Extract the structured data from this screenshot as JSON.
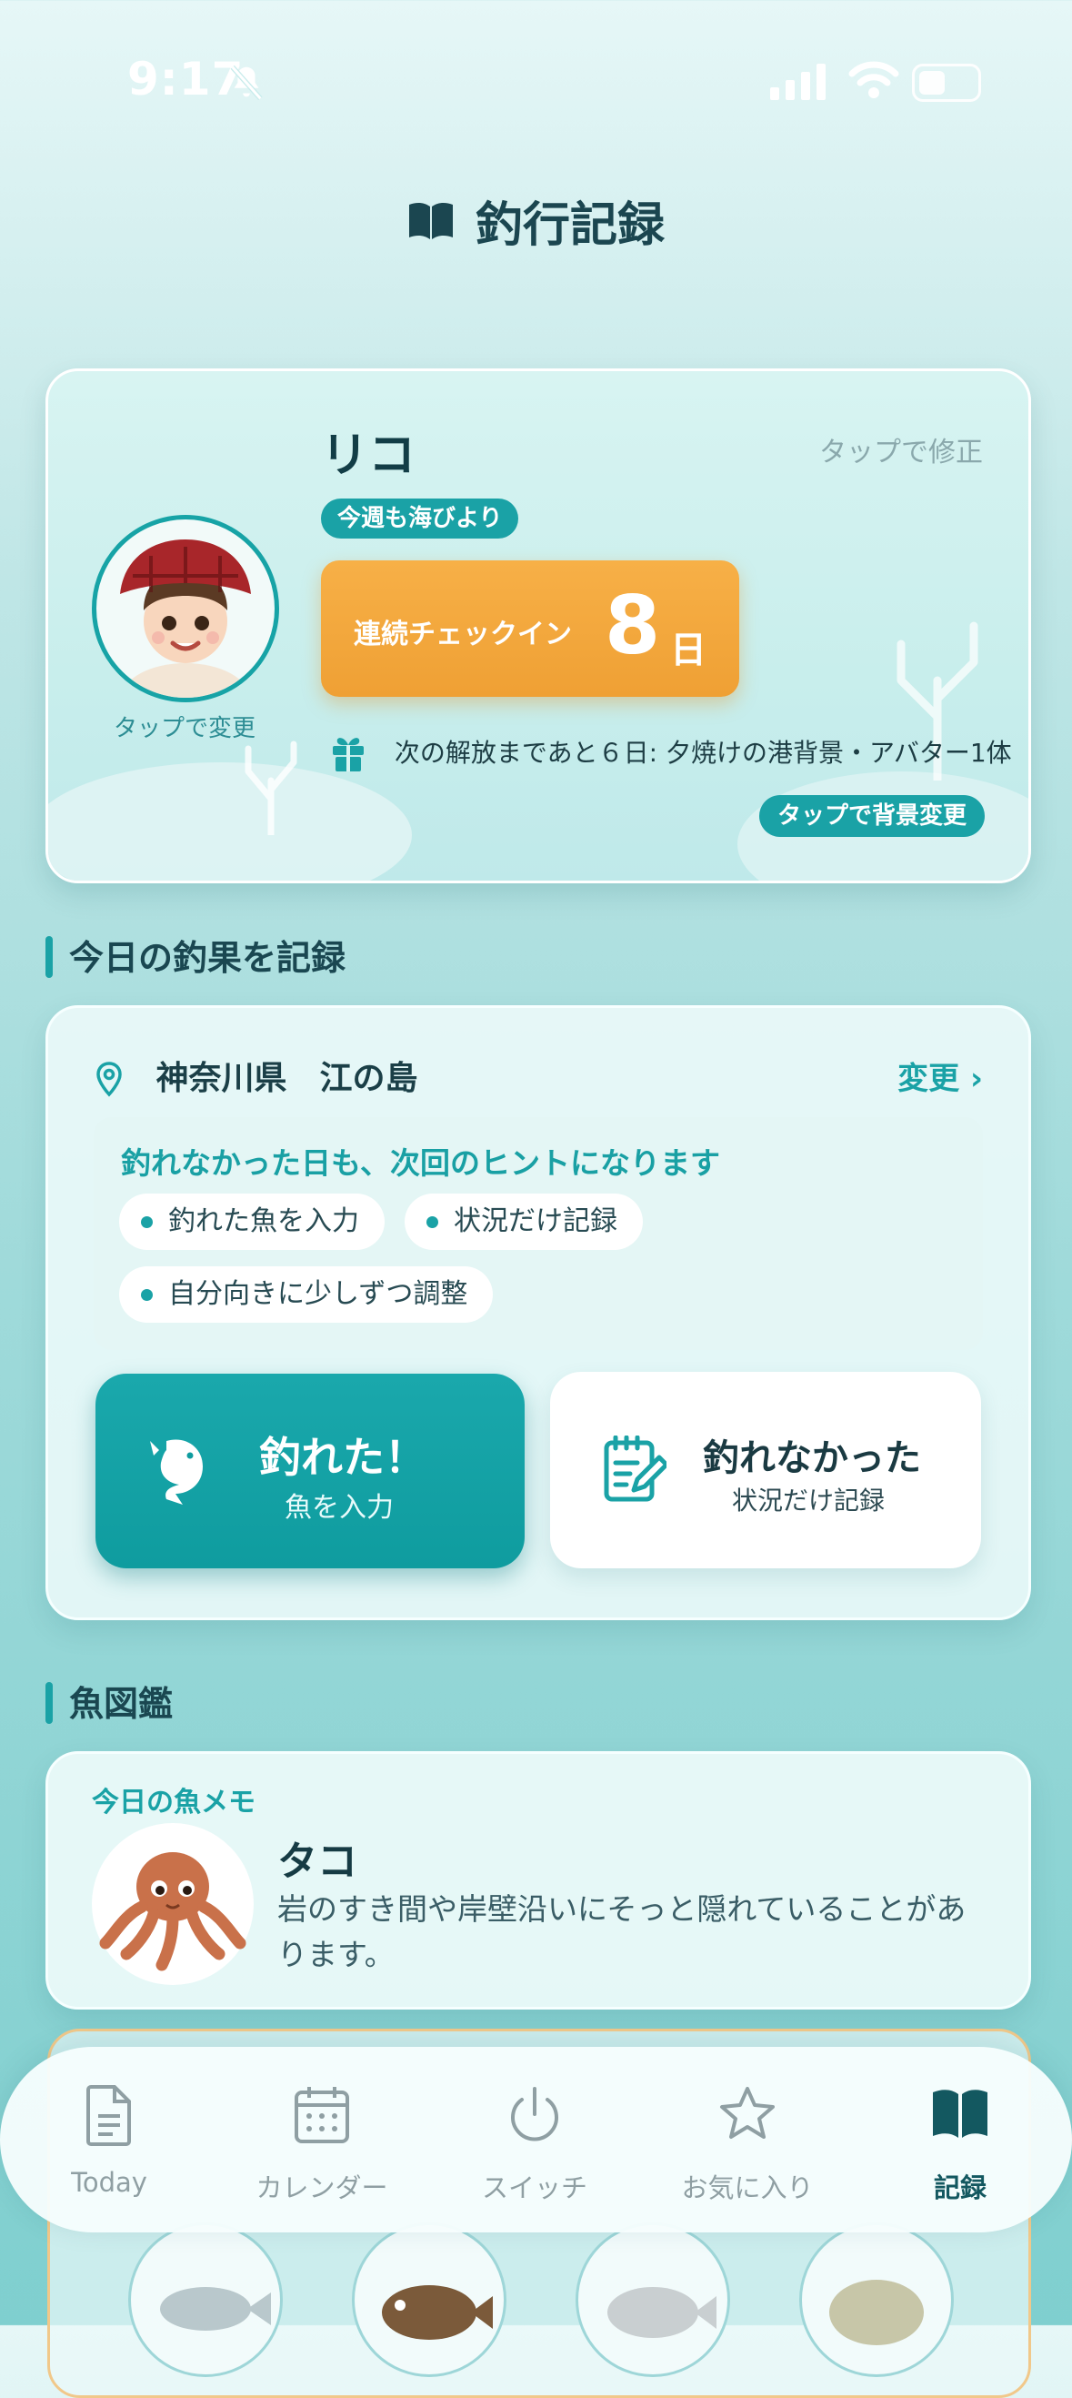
{
  "status_bar": {
    "time": "9:17"
  },
  "header": {
    "title": "釣行記録"
  },
  "profile": {
    "name": "リコ",
    "edit_hint": "タップで修正",
    "avatar_caption": "タップで変更",
    "week_badge": "今週も海びより",
    "streak_label": "連続チェックイン",
    "streak_days": "8",
    "streak_unit": "日",
    "unlock_text": "次の解放まであと６日: 夕焼けの港背景・アバター1体",
    "bg_button": "タップで背景変更"
  },
  "record_section": {
    "heading": "今日の釣果を記録",
    "location": "神奈川県　江の島",
    "change_label": "変更 ›",
    "hint_head": "釣れなかった日も、次回のヒントになります",
    "chips": [
      "釣れた魚を入力",
      "状況だけ記録",
      "自分向きに少しずつ調整"
    ],
    "caught_title": "釣れた！",
    "caught_sub": "魚を入力",
    "none_title": "釣れなかった",
    "none_sub": "状況だけ記録"
  },
  "zukan_section": {
    "heading": "魚図鑑",
    "memo_label": "今日の魚メモ",
    "fish_name": "タコ",
    "fish_desc": "岩のすき間や岸壁沿いにそっと隠れていることがあります。"
  },
  "tabbar": {
    "items": [
      {
        "label": "Today",
        "icon": "document-icon"
      },
      {
        "label": "カレンダー",
        "icon": "calendar-icon"
      },
      {
        "label": "スイッチ",
        "icon": "power-icon"
      },
      {
        "label": "お気に入り",
        "icon": "star-icon"
      },
      {
        "label": "記録",
        "icon": "book-icon"
      }
    ],
    "active": "記録"
  },
  "colors": {
    "accent": "#1aa2a6",
    "streak": "#f2a63b",
    "dark_text": "#14474f"
  }
}
